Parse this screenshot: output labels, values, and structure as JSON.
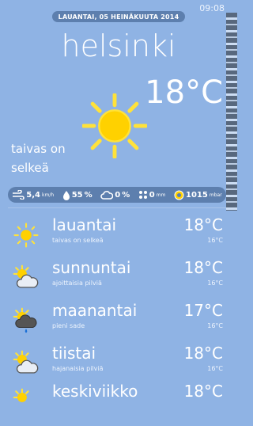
{
  "status": {
    "time": "09:08"
  },
  "header": {
    "date": "LAUANTAI, 05 HEINÄKUUTA 2014",
    "city": "helsinki"
  },
  "current": {
    "temperature": "18°C",
    "condition_line1": "taivas on",
    "condition_line2": "selkeä",
    "icon": "sun-icon"
  },
  "stats": {
    "wind": {
      "value": "5,4",
      "unit": "km/h",
      "icon": "wind-icon"
    },
    "humidity": {
      "value": "55",
      "unit": "%",
      "icon": "humidity-icon"
    },
    "cloud": {
      "value": "0",
      "unit": "%",
      "icon": "cloud-icon"
    },
    "precip": {
      "value": "0",
      "unit": "mm",
      "icon": "rain-icon"
    },
    "pressure": {
      "value": "1015",
      "unit": "mbar",
      "icon": "pressure-icon"
    }
  },
  "forecast": [
    {
      "day": "lauantai",
      "condition": "taivas on selkeä",
      "high": "18°C",
      "low": "16°C",
      "icon": "sun-icon"
    },
    {
      "day": "sunnuntai",
      "condition": "ajoittaisia pilviä",
      "high": "18°C",
      "low": "16°C",
      "icon": "partly-cloudy-icon"
    },
    {
      "day": "maanantai",
      "condition": "pieni sade",
      "high": "17°C",
      "low": "16°C",
      "icon": "rain-cloud-icon"
    },
    {
      "day": "tiistai",
      "condition": "hajanaisia pilviä",
      "high": "18°C",
      "low": "16°C",
      "icon": "partly-cloudy-icon"
    },
    {
      "day": "keskiviikko",
      "condition": "",
      "high": "18°C",
      "low": "",
      "icon": "partly-cloudy-icon"
    }
  ],
  "colors": {
    "background": "#8fb3e4",
    "pill": "#5d7fae",
    "sun": "#ffe23a",
    "sun_center": "#ffd100"
  }
}
